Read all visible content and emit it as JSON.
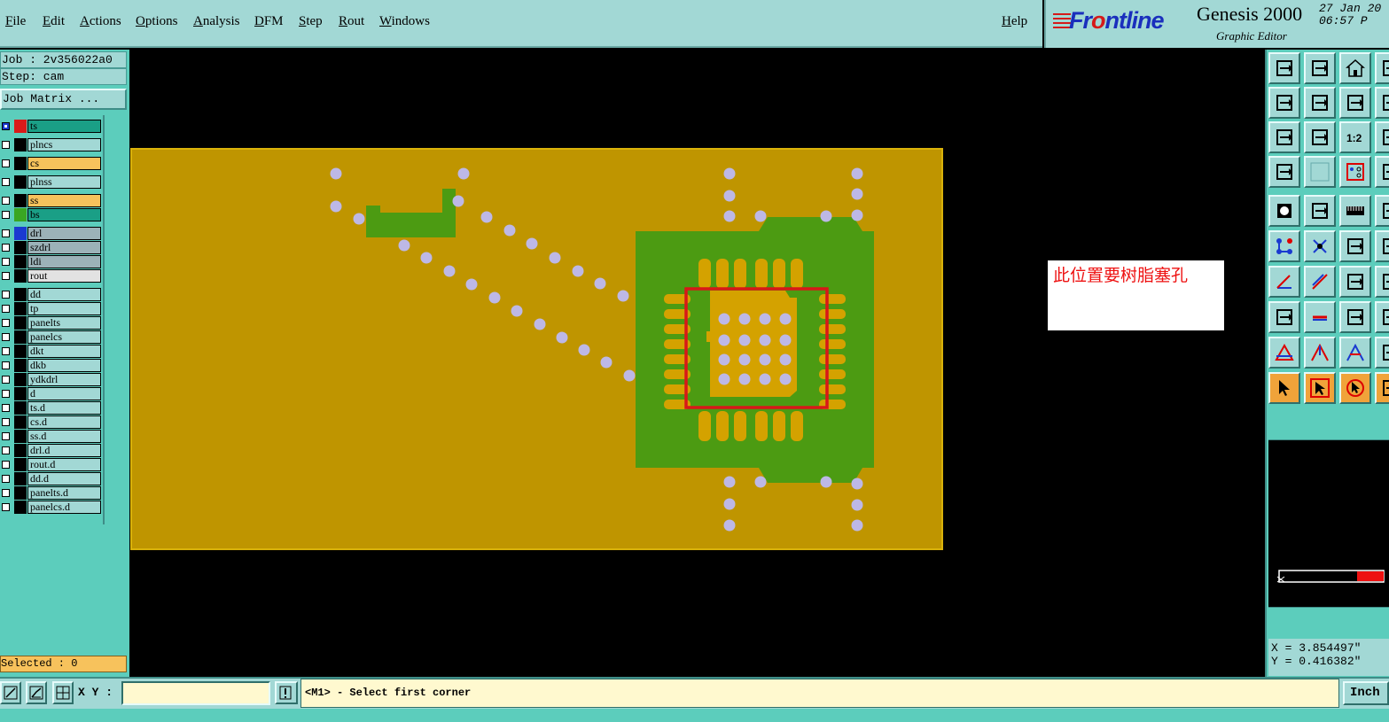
{
  "menu": [
    "File",
    "Edit",
    "Actions",
    "Options",
    "Analysis",
    "DFM",
    "Step",
    "Rout",
    "Windows"
  ],
  "help": "Help",
  "brand": {
    "logo_pre": "Fr",
    "logo_o": "o",
    "logo_post": "ntline",
    "product": "Genesis 2000",
    "subtitle": "Graphic Editor",
    "date": "27 Jan 20",
    "time": "06:57 P"
  },
  "job": {
    "job_line": "Job : 2v356022a0",
    "step_line": "Step: cam",
    "matrix_btn": "Job Matrix ..."
  },
  "layers": [
    {
      "name": "ts",
      "swatch": "#d91a1a",
      "bg": "#1a9f86",
      "sel": true
    },
    {
      "name": "plncs",
      "swatch": "#000000",
      "bg": "#a2d8d5"
    },
    {
      "name": "cs",
      "swatch": "#000000",
      "bg": "#f7c25c"
    },
    {
      "name": "plnss",
      "swatch": "#000000",
      "bg": "#a2d8d5"
    },
    {
      "name": "ss",
      "swatch": "#000000",
      "bg": "#f7c25c"
    },
    {
      "name": "bs",
      "swatch": "#3aa622",
      "bg": "#1a9f86"
    },
    {
      "name": "drl",
      "swatch": "#1a3ad0",
      "bg": "#9cb2b8"
    },
    {
      "name": "szdrl",
      "swatch": "#000000",
      "bg": "#9cb2b8"
    },
    {
      "name": "ldi",
      "swatch": "#000000",
      "bg": "#9cb2b8"
    },
    {
      "name": "rout",
      "swatch": "#000000",
      "bg": "#e2e2e2"
    },
    {
      "name": "dd",
      "swatch": "#000000",
      "bg": "#a2d8d5"
    },
    {
      "name": "tp",
      "swatch": "#000000",
      "bg": "#a2d8d5"
    },
    {
      "name": "panelts",
      "swatch": "#000000",
      "bg": "#a2d8d5"
    },
    {
      "name": "panelcs",
      "swatch": "#000000",
      "bg": "#a2d8d5"
    },
    {
      "name": "dkt",
      "swatch": "#000000",
      "bg": "#a2d8d5"
    },
    {
      "name": "dkb",
      "swatch": "#000000",
      "bg": "#a2d8d5"
    },
    {
      "name": "ydkdrl",
      "swatch": "#000000",
      "bg": "#a2d8d5"
    },
    {
      "name": "d",
      "swatch": "#000000",
      "bg": "#a2d8d5"
    },
    {
      "name": "ts.d",
      "swatch": "#000000",
      "bg": "#a2d8d5"
    },
    {
      "name": "cs.d",
      "swatch": "#000000",
      "bg": "#a2d8d5"
    },
    {
      "name": "ss.d",
      "swatch": "#000000",
      "bg": "#a2d8d5"
    },
    {
      "name": "drl.d",
      "swatch": "#000000",
      "bg": "#a2d8d5"
    },
    {
      "name": "rout.d",
      "swatch": "#000000",
      "bg": "#a2d8d5"
    },
    {
      "name": "dd.d",
      "swatch": "#000000",
      "bg": "#a2d8d5"
    },
    {
      "name": "panelts.d",
      "swatch": "#000000",
      "bg": "#a2d8d5"
    },
    {
      "name": "panelcs.d",
      "swatch": "#000000",
      "bg": "#a2d8d5"
    }
  ],
  "selected": "Selected : 0",
  "annotation": "此位置要树脂塞孔",
  "coords": {
    "x": "X = 3.854497\"",
    "y": "Y = 0.416382\""
  },
  "status": {
    "xy_label": "X Y :",
    "xy_value": "",
    "prompt": "<M1> - Select first corner",
    "unit": "Inch"
  },
  "colors": {
    "board": "#bf9500",
    "copper": "#4c9b12",
    "pad": "#d4a200",
    "hole": "#bdb8e6",
    "highlight": "#d81818"
  },
  "toolbar_icons": [
    [
      "open-layer-icon",
      "save-layer-icon",
      "home-icon",
      "page-icon"
    ],
    [
      "move-left-icon",
      "move-right-icon",
      "swap-icon",
      "panel-icon"
    ],
    [
      "fit-screen-icon",
      "zoom-center-icon",
      "scale-1-2-icon",
      "frame-icon"
    ],
    [
      "tools-icon",
      "grid-icon",
      "snap-icon",
      "snap-alt-icon"
    ],
    [
      "fill-icon",
      "polygon-icon",
      "ruler-icon",
      "circle-icon"
    ],
    [
      "connect-icon",
      "cross-icon",
      "line-node-icon",
      "node-icon"
    ],
    [
      "angle-icon",
      "draw-line-icon",
      "arc-icon",
      "text-icon"
    ],
    [
      "pad-add-icon",
      "minus-icon",
      "measure-icon",
      "measure-alt-icon"
    ],
    [
      "triangle-icon",
      "arrow-up-icon",
      "arch-icon",
      "arrow-icon"
    ],
    [
      "select-arrow-icon",
      "select-box-icon",
      "select-circle-icon",
      "select-alt-icon"
    ]
  ]
}
